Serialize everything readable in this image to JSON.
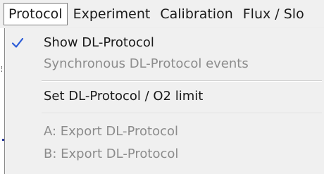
{
  "menubar": {
    "items": [
      {
        "label": "Protocol"
      },
      {
        "label": "Experiment"
      },
      {
        "label": "Calibration"
      },
      {
        "label": "Flux / Slo"
      }
    ]
  },
  "dropdown": {
    "items": [
      {
        "label": "Show DL-Protocol",
        "checked": true,
        "enabled": true,
        "check_icon": "checkmark-icon"
      },
      {
        "label": "Synchronous DL-Protocol events",
        "checked": false,
        "enabled": false
      },
      {
        "label": "Set DL-Protocol / O2 limit",
        "checked": false,
        "enabled": true
      },
      {
        "label": "A: Export DL-Protocol",
        "checked": false,
        "enabled": false
      },
      {
        "label": "B: Export DL-Protocol",
        "checked": false,
        "enabled": false
      }
    ]
  },
  "colors": {
    "menu_background": "#f0f0f0",
    "enabled_text": "#1a1a1a",
    "disabled_text": "#8c8c8c",
    "checkmark": "#2a5bd7"
  }
}
